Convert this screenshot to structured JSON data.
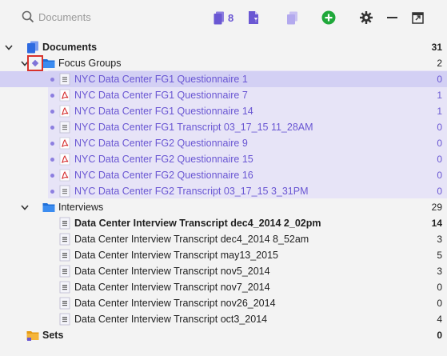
{
  "toolbar": {
    "search_placeholder": "Documents",
    "doc_count": "8",
    "icons": [
      "search-icon",
      "documents-icon",
      "filter-doc-icon",
      "copy-doc-icon",
      "add-icon",
      "gear-icon",
      "minimize-icon",
      "popout-icon"
    ],
    "accent": "#6a57d3",
    "add_color": "#1fa83a"
  },
  "tree": {
    "root": {
      "label": "Documents",
      "count": "31"
    },
    "focus_groups": {
      "label": "Focus Groups",
      "count": "2",
      "items": [
        {
          "label": "NYC Data Center FG1 Questionnaire 1",
          "count": "0",
          "type": "text"
        },
        {
          "label": "NYC Data Center FG1 Questionnaire 7",
          "count": "1",
          "type": "pdf"
        },
        {
          "label": "NYC Data Center FG1 Questionnaire 14",
          "count": "1",
          "type": "pdf"
        },
        {
          "label": "NYC Data Center FG1 Transcript 03_17_15 11_28AM",
          "count": "0",
          "type": "text"
        },
        {
          "label": "NYC Data Center FG2 Questionnaire 9",
          "count": "0",
          "type": "pdf"
        },
        {
          "label": "NYC Data Center FG2 Questionnaire 15",
          "count": "0",
          "type": "pdf"
        },
        {
          "label": "NYC Data Center FG2 Questionnaire 16",
          "count": "0",
          "type": "pdf"
        },
        {
          "label": "NYC Data Center FG2 Transcript 03_17_15 3_31PM",
          "count": "0",
          "type": "text"
        }
      ]
    },
    "interviews": {
      "label": "Interviews",
      "count": "29",
      "items": [
        {
          "label": "Data Center Interview Transcript dec4_2014 2_02pm",
          "count": "14",
          "bold": true
        },
        {
          "label": "Data Center Interview Transcript dec4_2014 8_52am",
          "count": "3"
        },
        {
          "label": "Data Center Interview Transcript may13_2015",
          "count": "5"
        },
        {
          "label": "Data Center Interview Transcript nov5_2014",
          "count": "3"
        },
        {
          "label": "Data Center Interview Transcript nov7_2014",
          "count": "0"
        },
        {
          "label": "Data Center Interview Transcript nov26_2014",
          "count": "0"
        },
        {
          "label": "Data Center Interview Transcript oct3_2014",
          "count": "4"
        }
      ]
    },
    "sets": {
      "label": "Sets",
      "count": "0"
    }
  }
}
